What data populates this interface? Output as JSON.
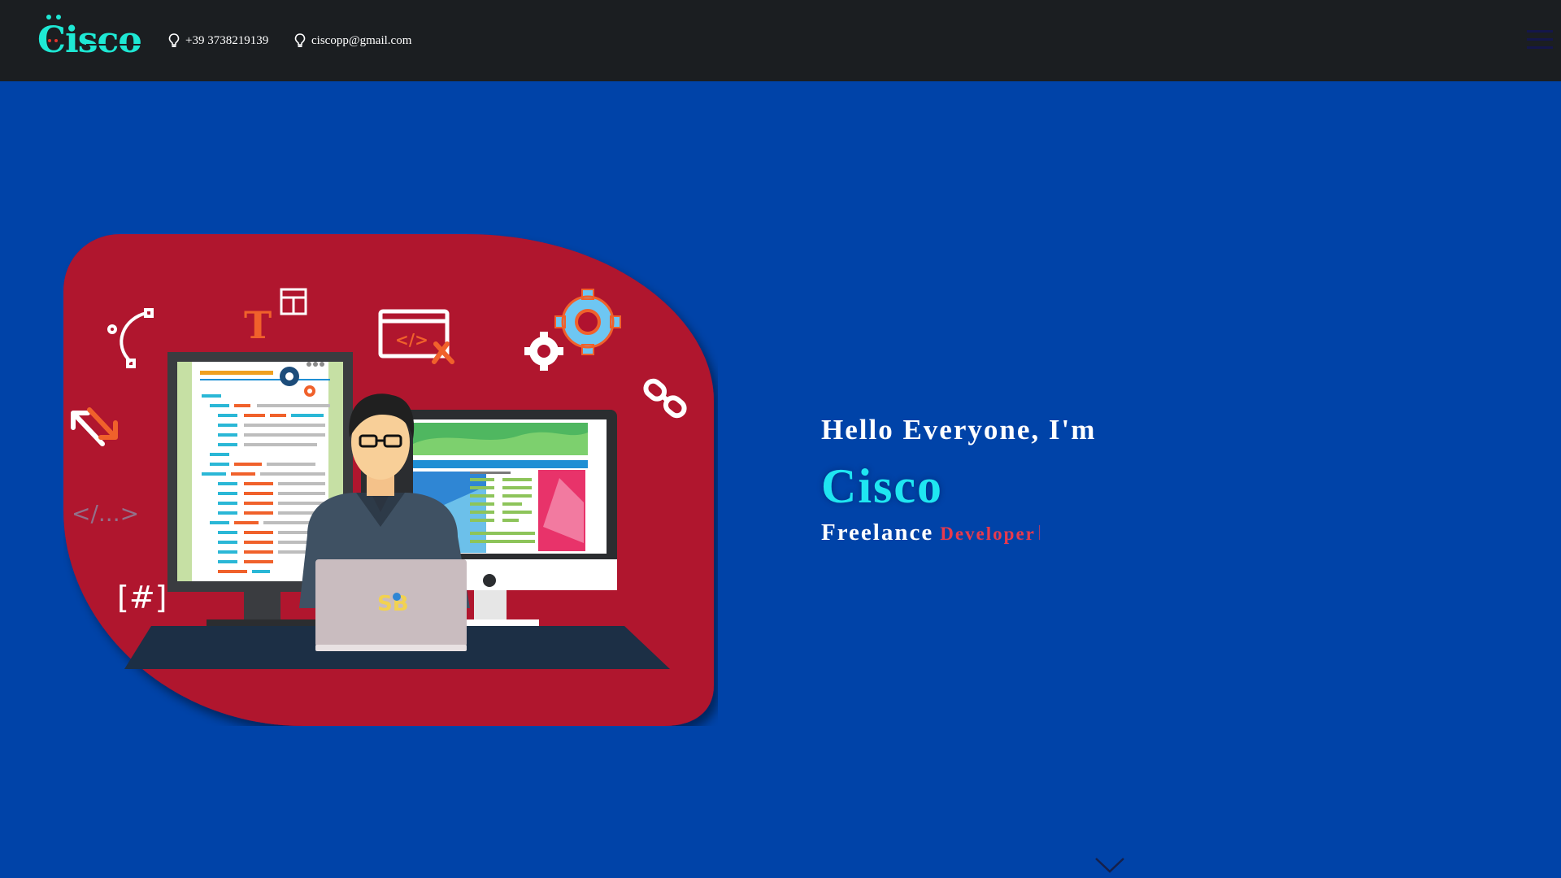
{
  "header": {
    "logo_text": "Cisco",
    "phone": "+39 3738219139",
    "email": "ciscopp@gmail.com"
  },
  "hero": {
    "greeting": "Hello Everyone, I'm",
    "name": "Cisco",
    "role_static": "Freelance",
    "role_typed": "Developer"
  },
  "illustration": {
    "badge_text": "SB",
    "code_tag": "</>",
    "closing_tag": "</...>",
    "hash_tag": "[#]",
    "type_letter": "T"
  },
  "colors": {
    "page_bg": "#0043a8",
    "topbar_bg": "#1b1e21",
    "accent_cyan": "#1fe6f1",
    "accent_red": "#e83a4d",
    "blob": "#b0122f"
  },
  "icons": [
    "location-pin-icon",
    "menu-icon",
    "chevron-down-icon"
  ]
}
